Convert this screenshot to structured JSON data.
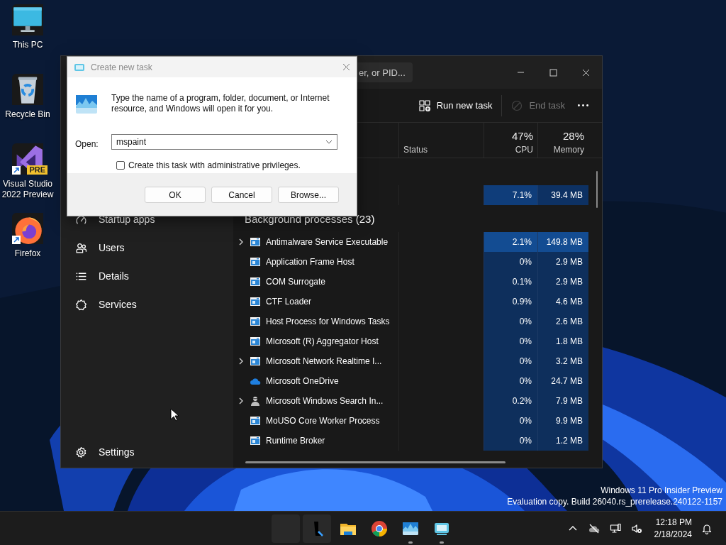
{
  "desktop": {
    "icons": [
      {
        "label": "This PC",
        "kind": "monitor"
      },
      {
        "label": "Recycle Bin",
        "kind": "recycle"
      },
      {
        "label": "Visual Studio 2022 Preview",
        "kind": "vs",
        "badge": "PRE",
        "shortcut": true
      },
      {
        "label": "Firefox",
        "kind": "firefox",
        "shortcut": true
      }
    ],
    "build_notice": [
      "Windows 11 Pro Insider Preview",
      "Evaluation copy. Build 26040.rs_prerelease.240122-1157"
    ]
  },
  "task_manager": {
    "search": {
      "placeholder": "er, or PID..."
    },
    "sidebar": {
      "items": [
        {
          "label": "Startup apps",
          "selected": false
        },
        {
          "label": "Users",
          "selected": false
        },
        {
          "label": "Details",
          "selected": false
        },
        {
          "label": "Services",
          "selected": false
        }
      ],
      "settings": "Settings"
    },
    "toolbar": [
      {
        "label": "Run new task",
        "kind": "run",
        "disabled": false
      },
      {
        "label": "End task",
        "kind": "end",
        "disabled": true
      },
      {
        "kind": "more",
        "disabled": false
      }
    ],
    "columns": [
      {
        "label": "Status"
      },
      {
        "label": "CPU",
        "usage": "47%"
      },
      {
        "label": "Memory",
        "usage": "28%"
      }
    ],
    "rows": [
      {
        "kind": "row",
        "cpu": {
          "value": "7.1%",
          "color": "#0f3d7a"
        },
        "memory": {
          "value": "39.4 MB",
          "color": "#0d3163"
        }
      },
      {
        "kind": "group",
        "label": "Background processes (23)"
      },
      {
        "kind": "app",
        "name": "Antimalware Service Executable",
        "expandable": true,
        "cpu": {
          "value": "2.1%",
          "color": "#134c92"
        },
        "memory": {
          "value": "149.8 MB",
          "color": "#134c92"
        }
      },
      {
        "kind": "app",
        "name": "Application Frame Host",
        "expandable": false,
        "cpu": {
          "value": "0%",
          "color": "#0e2f5c"
        },
        "memory": {
          "value": "2.9 MB",
          "color": "#0e2f5c"
        }
      },
      {
        "kind": "app",
        "name": "COM Surrogate",
        "expandable": false,
        "cpu": {
          "value": "0.1%",
          "color": "#0e2f5c"
        },
        "memory": {
          "value": "2.9 MB",
          "color": "#0e2f5c"
        }
      },
      {
        "kind": "app",
        "name": "CTF Loader",
        "expandable": false,
        "cpu": {
          "value": "0.9%",
          "color": "#0e2f5c"
        },
        "memory": {
          "value": "4.6 MB",
          "color": "#0e2f5c"
        }
      },
      {
        "kind": "app",
        "name": "Host Process for Windows Tasks",
        "expandable": false,
        "cpu": {
          "value": "0%",
          "color": "#0e2f5c"
        },
        "memory": {
          "value": "2.6 MB",
          "color": "#0e2f5c"
        }
      },
      {
        "kind": "app",
        "name": "Microsoft (R) Aggregator Host",
        "expandable": false,
        "cpu": {
          "value": "0%",
          "color": "#0e2f5c"
        },
        "memory": {
          "value": "1.8 MB",
          "color": "#0e2f5c"
        }
      },
      {
        "kind": "app",
        "name": "Microsoft Network Realtime I...",
        "expandable": true,
        "cpu": {
          "value": "0%",
          "color": "#0e2f5c"
        },
        "memory": {
          "value": "3.2 MB",
          "color": "#0e2f5c"
        }
      },
      {
        "kind": "cloud",
        "name": "Microsoft OneDrive",
        "expandable": false,
        "cpu": {
          "value": "0%",
          "color": "#0e2f5c"
        },
        "memory": {
          "value": "24.7 MB",
          "color": "#0e2f5c"
        }
      },
      {
        "kind": "person",
        "name": "Microsoft Windows Search In...",
        "expandable": true,
        "cpu": {
          "value": "0.2%",
          "color": "#0e2f5c"
        },
        "memory": {
          "value": "7.9 MB",
          "color": "#0e2f5c"
        }
      },
      {
        "kind": "app",
        "name": "MoUSO Core Worker Process",
        "expandable": false,
        "cpu": {
          "value": "0%",
          "color": "#0e2f5c"
        },
        "memory": {
          "value": "9.9 MB",
          "color": "#0e2f5c"
        }
      },
      {
        "kind": "app",
        "name": "Runtime Broker",
        "expandable": false,
        "cpu": {
          "value": "0%",
          "color": "#0e2f5c"
        },
        "memory": {
          "value": "1.2 MB",
          "color": "#0e2f5c"
        }
      }
    ]
  },
  "run_dialog": {
    "title": "Create new task",
    "message": "Type the name of a program, folder, document, or Internet resource, and Windows will open it for you.",
    "open_label": "Open:",
    "value": "mspaint",
    "checkbox": {
      "label": "Create this task with administrative privileges.",
      "checked": false
    },
    "buttons": [
      "OK",
      "Cancel",
      "Browse..."
    ]
  },
  "taskbar": {
    "apps": [
      {
        "kind": "start"
      },
      {
        "kind": "search"
      },
      {
        "kind": "explorer"
      },
      {
        "kind": "chrome"
      },
      {
        "kind": "wave",
        "running": true
      },
      {
        "kind": "remote",
        "running": true
      }
    ],
    "time": "12:18 PM",
    "date": "2/18/2024"
  }
}
